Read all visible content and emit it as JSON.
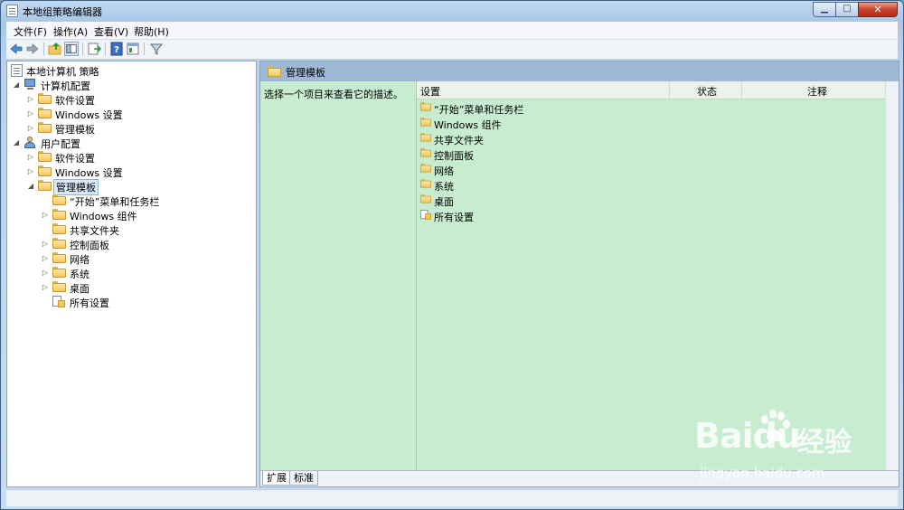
{
  "window": {
    "title": "本地组策略编辑器"
  },
  "menu": [
    "文件(F)",
    "操作(A)",
    "查看(V)",
    "帮助(H)"
  ],
  "tree": {
    "root": "本地计算机 策略",
    "computer_config": {
      "label": "计算机配置",
      "children": [
        "软件设置",
        "Windows 设置",
        "管理模板"
      ]
    },
    "user_config": {
      "label": "用户配置",
      "children": [
        "软件设置",
        "Windows 设置",
        "管理模板"
      ],
      "admin_templates": [
        "“开始”菜单和任务栏",
        "Windows 组件",
        "共享文件夹",
        "控制面板",
        "网络",
        "系统",
        "桌面",
        "所有设置"
      ]
    }
  },
  "right": {
    "header": "管理模板",
    "description": "选择一个项目来查看它的描述。",
    "columns": [
      "设置",
      "状态",
      "注释"
    ],
    "items": [
      "“开始”菜单和任务栏",
      "Windows 组件",
      "共享文件夹",
      "控制面板",
      "网络",
      "系统",
      "桌面",
      "所有设置"
    ],
    "tabs": [
      "扩展",
      "标准"
    ]
  },
  "watermark": {
    "brand": "Baidu",
    "brand_cn": "经验",
    "url": "jingyan.baidu.com"
  }
}
